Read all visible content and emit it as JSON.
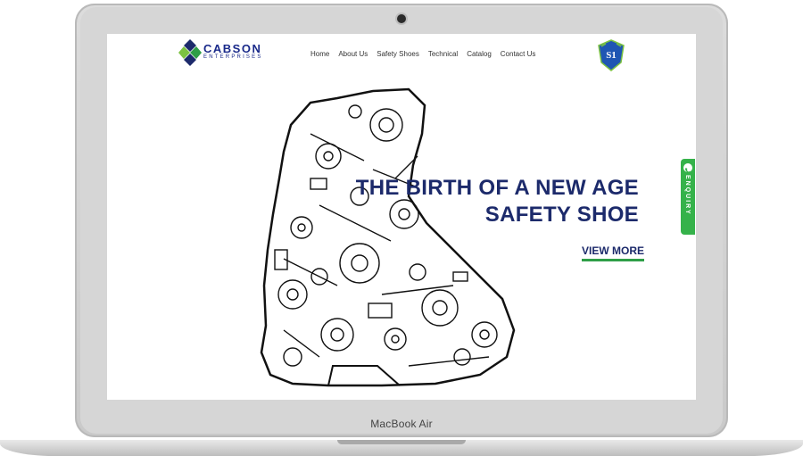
{
  "device": {
    "model_label": "MacBook Air"
  },
  "site": {
    "logo": {
      "name": "CABSON",
      "sub": "ENTERPRISES"
    },
    "nav": [
      {
        "label": "Home"
      },
      {
        "label": "About Us"
      },
      {
        "label": "Safety Shoes"
      },
      {
        "label": "Technical"
      },
      {
        "label": "Catalog"
      },
      {
        "label": "Contact Us"
      }
    ],
    "badge": {
      "text": "S1"
    },
    "hero": {
      "title_line1": "THE BIRTH OF A NEW AGE",
      "title_line2": "SAFETY SHOE",
      "cta_label": "VIEW MORE"
    },
    "enquiry": {
      "label": "ENQUIRY"
    }
  },
  "colors": {
    "brand_navy": "#1c2a6b",
    "accent_green": "#35b24a",
    "underline_green": "#2e9e47"
  },
  "icons": {
    "logo_mark": "diamond-logo-icon",
    "phone": "phone-icon",
    "shield": "shield-badge-icon"
  }
}
